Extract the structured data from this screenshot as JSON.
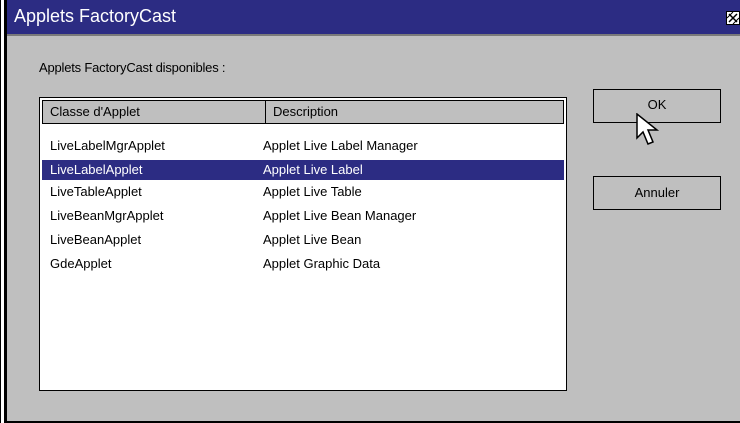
{
  "window": {
    "title": "Applets FactoryCast"
  },
  "dialog": {
    "subtitle": "Applets FactoryCast disponibles :",
    "columns": {
      "class_header": "Classe d'Applet",
      "description_header": "Description"
    },
    "rows": [
      {
        "class": "LiveLabelMgrApplet",
        "description": "Applet Live Label Manager",
        "selected": false
      },
      {
        "class": "LiveLabelApplet",
        "description": "Applet Live Label",
        "selected": true
      },
      {
        "class": "LiveTableApplet",
        "description": "Applet Live Table",
        "selected": false
      },
      {
        "class": "LiveBeanMgrApplet",
        "description": "Applet Live Bean Manager",
        "selected": false
      },
      {
        "class": "LiveBeanApplet",
        "description": "Applet Live Bean",
        "selected": false
      },
      {
        "class": "GdeApplet",
        "description": "Applet Graphic Data",
        "selected": false
      }
    ],
    "buttons": {
      "ok_label": "OK",
      "cancel_label": "Annuler"
    }
  },
  "colors": {
    "titlebar": "#2c2c83",
    "selection": "#2c2c83",
    "dialog_bg": "#bfbfbf"
  },
  "icons": {
    "close": "close-icon",
    "cursor": "mouse-pointer-icon"
  }
}
